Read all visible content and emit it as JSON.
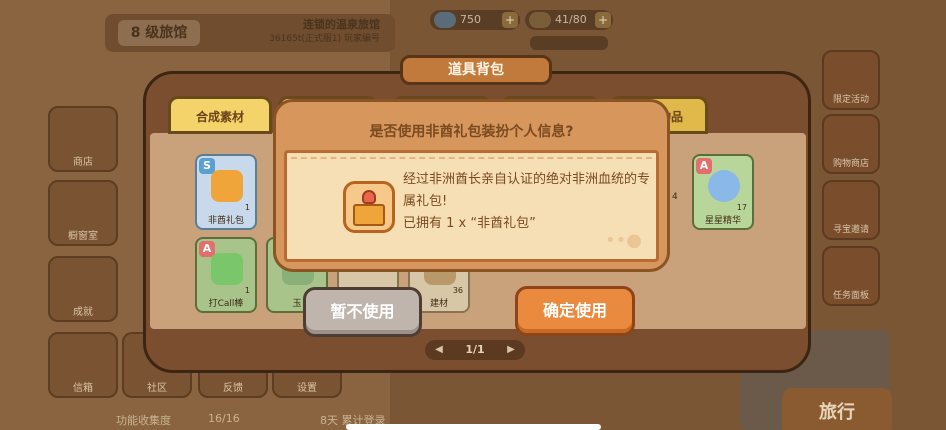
{
  "background": {
    "level_label": "8 级旅馆",
    "hotel_name": "连锁的温泉旅馆",
    "hotel_id": "36165t(正式服1) 玩家编号",
    "resources": [
      {
        "value": "750"
      },
      {
        "value": "41/80"
      }
    ],
    "left_buttons": [
      "商店",
      "橱窗室",
      "成就",
      "信箱",
      "社区",
      "反馈",
      "设置"
    ],
    "right_buttons": [
      "限定活动",
      "购物商店",
      "寻宝邀请",
      "任务面板"
    ],
    "travel_label": "旅行",
    "func_collect_label": "功能收集度",
    "func_collect_value": "16/16",
    "signin_label": "8天 累计登录"
  },
  "backpack": {
    "title": "道具背包",
    "tabs": [
      {
        "label": "合成素材",
        "active": true
      },
      {
        "label": "",
        "active": false
      },
      {
        "label": "",
        "active": false
      },
      {
        "label": "",
        "active": false
      },
      {
        "label": "物品",
        "active": false
      }
    ],
    "items": [
      {
        "rarity": "S",
        "name": "非酋礼包",
        "count": "1",
        "color": "#f0a53a"
      },
      {
        "rarity": "A",
        "name": "星星精华",
        "count": "17",
        "color": "#8ab8e8"
      },
      {
        "rarity": "A",
        "name": "打Call棒",
        "count": "1",
        "color": "#7ac66a"
      },
      {
        "rarity": "",
        "name": "玉",
        "count": "6",
        "color": "#8ab07a"
      },
      {
        "rarity": "",
        "name": "",
        "count": "0",
        "color": "#c9a17a"
      },
      {
        "rarity": "",
        "name": "建材",
        "count": "36",
        "color": "#b89a6a"
      }
    ],
    "side_count": "4",
    "pager": "1/1"
  },
  "dialog": {
    "title": "是否使用非酋礼包装扮个人信息?",
    "line1": "经过非洲酋长亲自认证的绝对非洲血统的专",
    "line2": "属礼包!",
    "line3": "已拥有 1 x “非酋礼包”",
    "cancel_label": "暂不使用",
    "confirm_label": "确定使用"
  },
  "colors": {
    "accent": "#e98a3e",
    "panel": "#7a4e2e",
    "dialog": "#d7965c"
  }
}
